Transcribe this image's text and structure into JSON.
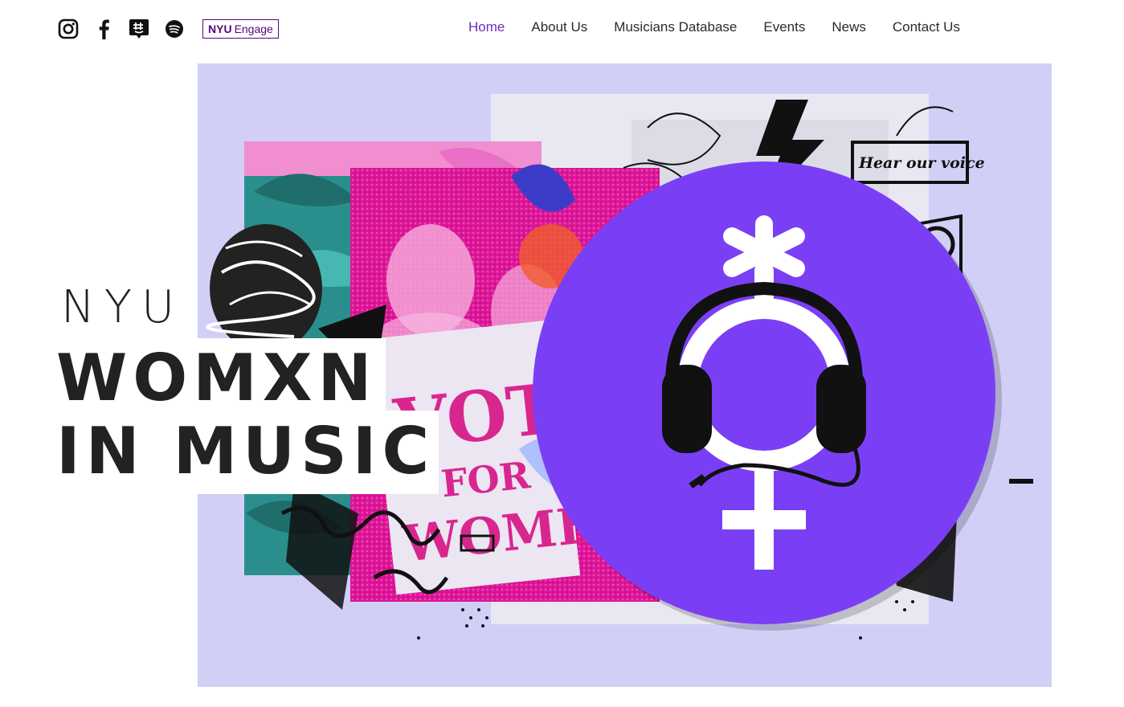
{
  "header": {
    "social_icons": [
      "instagram-icon",
      "facebook-icon",
      "groupme-icon",
      "spotify-icon"
    ],
    "engage_badge": {
      "bold": "NYU",
      "rest": "Engage"
    },
    "nav": [
      {
        "label": "Home",
        "active": true
      },
      {
        "label": "About Us",
        "active": false
      },
      {
        "label": "Musicians Database",
        "active": false
      },
      {
        "label": "Events",
        "active": false
      },
      {
        "label": "News",
        "active": false
      },
      {
        "label": "Contact Us",
        "active": false
      }
    ]
  },
  "hero": {
    "prefix": "NYU",
    "title_line1": "WOMXN",
    "title_line2": "IN MUSIC",
    "collage_sign_text": "VOTE",
    "collage_sign_text2": "FOR",
    "collage_sign_text3": "WOMEN",
    "collage_note": "Hear our voice",
    "colors": {
      "background": "#d2cff7",
      "logo_circle": "#7a3ff5",
      "accent_pink": "#e0169a",
      "accent_teal": "#2e9e9a",
      "nav_active": "#6a2fb5"
    }
  }
}
